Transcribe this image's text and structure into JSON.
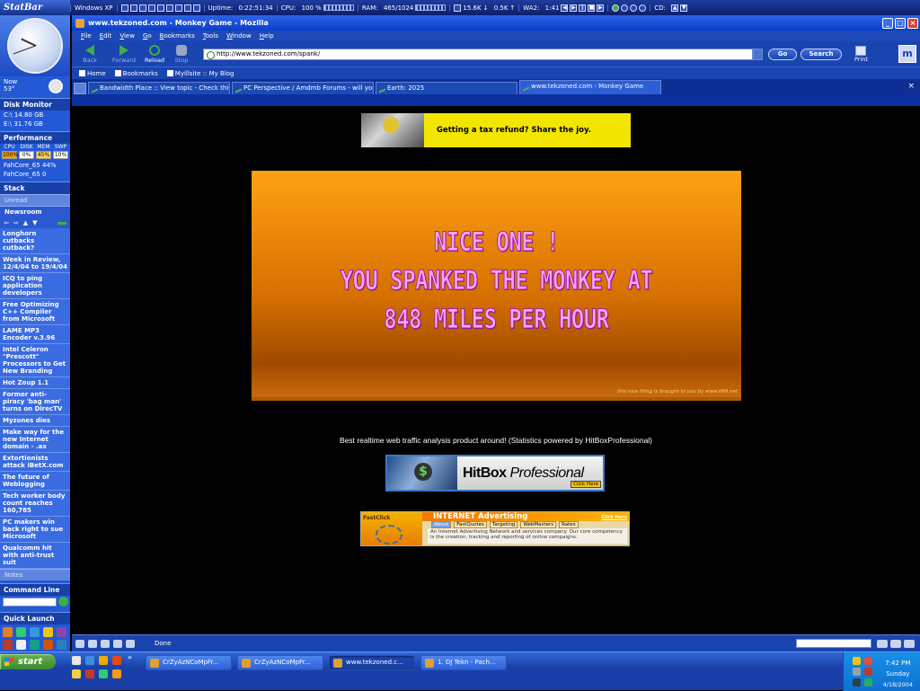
{
  "statbar": {
    "logo": "StatBar",
    "os": "Windows XP",
    "uptime_label": "Uptime:",
    "uptime_value": "0:22:51:34",
    "cpu_label": "CPU:",
    "cpu_value": "100 %",
    "ram_label": "RAM:",
    "ram_value": "465/1024",
    "net_down": "15.6K",
    "net_up": "0.5K",
    "wa_label": "WA2:",
    "wa_value": "1:41",
    "cd_label": "CD:"
  },
  "sidebar": {
    "weather_now": "Now",
    "weather_temp": "53°",
    "disk_title": "Disk Monitor",
    "disk_c": "C:\\ 14.80 GB",
    "disk_e": "E:\\ 31.76 GB",
    "perf_title": "Performance",
    "perf_headers": [
      "CPU",
      "DISK",
      "MEM",
      "SWP"
    ],
    "perf_values": [
      "100%",
      "0%",
      "45%",
      "10%"
    ],
    "fah1": "FahCore_65 44%",
    "fah2": "FahCore_65 0",
    "stack_title": "Stack",
    "tab_unread": "Unread",
    "tab_newsroom": "Newsroom",
    "news": [
      "Longhorn cutbacks cutback?",
      "Week in Review, 12/4/04 to 19/4/04",
      "ICQ to ping application developers",
      "Free Optimizing C++ Compiler from Microsoft",
      "LAME MP3 Encoder v.3.96",
      "Intel Celeron \"Prescott\" Processors to Get New Branding",
      "Hot Zoup 1.1",
      "Former anti-piracy 'bag man' turns on DirecTV",
      "Myzones dies",
      "Make way for the new Internet domain - .ax",
      "Extortionists attack iBetX.com",
      "The future of Weblogging",
      "Tech worker body count reaches 160,785",
      "PC makers win back right to sue Microsoft",
      "Qualcomm hit with anti-trust suit"
    ],
    "tab_notes": "Notes",
    "cmd_title": "Command Line",
    "ql_title": "Quick Launch"
  },
  "browser": {
    "title": "www.tekzoned.com - Monkey Game - Mozilla",
    "menu": [
      "File",
      "Edit",
      "View",
      "Go",
      "Bookmarks",
      "Tools",
      "Window",
      "Help"
    ],
    "nav": {
      "back": "Back",
      "forward": "Forward",
      "reload": "Reload",
      "stop": "Stop"
    },
    "url": "http://www.tekzoned.com/spank/",
    "go": "Go",
    "search": "Search",
    "print": "Print",
    "personal": [
      "Home",
      "Bookmarks",
      "Myillsite :: My Blog"
    ],
    "tabs": [
      "Bandwidth Place :: View topic - Check this si...",
      "PC Perspective / Amdmb Forums - will you s...",
      "Earth: 2025",
      "www.tekzoned.com - Monkey Game"
    ],
    "status": "Done"
  },
  "page": {
    "ad1_text": "Getting a tax refund?  Share the joy.",
    "game_lines": [
      "NICE ONE !",
      "YOU SPANKED THE MONKEY AT",
      "848 MILES PER HOUR"
    ],
    "game_credit": "this nice thing is brought to you by www.k69.net",
    "hitbox_text": "Best realtime web traffic analysis product around! (Statistics powered by HitBoxProfessional)",
    "hitbox_brand_bold": "HitBox",
    "hitbox_brand_rest": " Professional",
    "hitbox_click": "Click Here",
    "fc_logo": "FastClick",
    "fc_header": "INTERNET Advertising",
    "fc_click": "Click Here",
    "fc_tabs": [
      "About",
      "FastQuotes",
      "Targeting",
      "WebMasters",
      "Rates"
    ],
    "fc_body": "An Internet Advertising Network and services company. Our core competency is the creation, tracking and reporting of online campaigns."
  },
  "taskbar": {
    "start": "start",
    "buttons": [
      "CrZyAzNCoMpFr...",
      "CrZyAzNCoMpFr...",
      "www.tekzoned.c...",
      "1. DJ Tekn - Pach..."
    ],
    "time": "7:42 PM",
    "day": "Sunday",
    "date": "4/18/2004"
  }
}
